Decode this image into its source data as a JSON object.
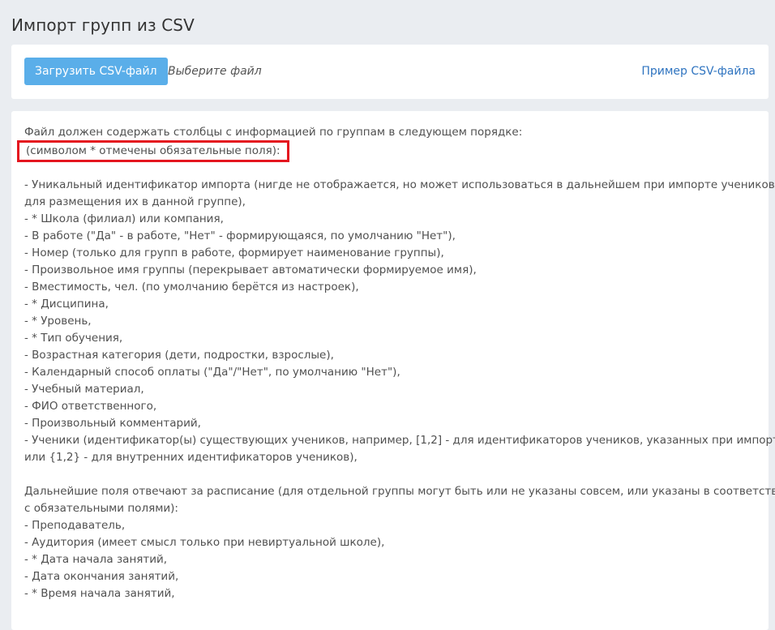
{
  "page": {
    "title": "Импорт групп из CSV"
  },
  "upload": {
    "button_label": "Загрузить CSV-файл",
    "file_status": "Выберите файл",
    "example_link": "Пример CSV-файла"
  },
  "info": {
    "intro": "Файл должен содержать столбцы с информацией по группам в следующем порядке:",
    "required_note": "(символом * отмечены обязательные поля):",
    "fields": [
      "- Уникальный идентификатор импорта (нигде не отображается, но может использоваться в дальнейшем при импорте учеников",
      "для размещения их в данной группе),",
      "- * Школа (филиал) или компания,",
      "- В работе (\"Да\" - в работе, \"Нет\" - формирующаяся, по умолчанию \"Нет\"),",
      "- Номер (только для групп в работе, формирует наименование группы),",
      "- Произвольное имя группы (перекрывает автоматически формируемое имя),",
      "- Вместимость, чел. (по умолчанию берётся из настроек),",
      "- * Дисципина,",
      "- * Уровень,",
      "- * Тип обучения,",
      "- Возрастная категория (дети, подростки, взрослые),",
      "- Календарный способ оплаты (\"Да\"/\"Нет\", по умолчанию \"Нет\"),",
      "- Учебный материал,",
      "- ФИО ответственного,",
      "- Произвольный комментарий,",
      "- Ученики (идентификатор(ы) существующих учеников, например, [1,2] - для идентификаторов учеников, указанных при импорте,",
      "или {1,2} - для внутренних идентификаторов учеников),"
    ],
    "schedule_intro": [
      "Дальнейшие поля отвечают за расписание (для отдельной группы могут быть или не указаны совсем, или указаны в соответствии",
      "с обязательными полями):"
    ],
    "schedule_fields": [
      "- Преподаватель,",
      "- Аудитория (имеет смысл только при невиртуальной школе),",
      "- * Дата начала занятий,",
      "- Дата окончания занятий,",
      "- * Время начала занятий,"
    ]
  }
}
